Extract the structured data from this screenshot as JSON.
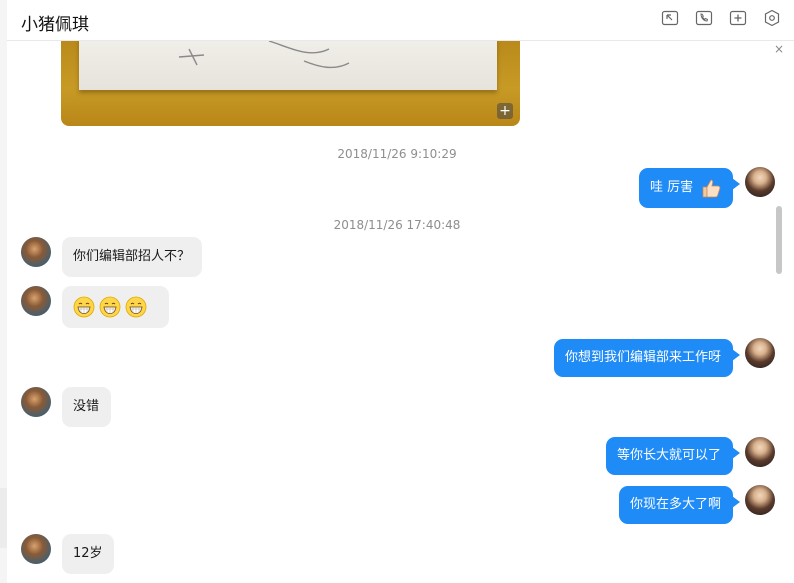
{
  "header": {
    "title": "小猪佩琪",
    "icons": [
      "minimize-corner-icon",
      "phone-icon",
      "add-icon",
      "settings-hexagon-icon"
    ]
  },
  "collapse_icon": "×",
  "timestamps": [
    "2018/11/26 9:10:29",
    "2018/11/26 17:40:48"
  ],
  "messages": [
    {
      "side": "out",
      "text": "哇 厉害",
      "emoji": "thumbs-up-icon"
    },
    {
      "side": "in",
      "text": "你们编辑部招人不？"
    },
    {
      "side": "in",
      "text": "",
      "emoji": "grinning-face-icon x3"
    },
    {
      "side": "out",
      "text": "你想到我们编辑部来工作呀"
    },
    {
      "side": "in",
      "text": "没错"
    },
    {
      "side": "out",
      "text": "等你长大就可以了"
    },
    {
      "side": "out",
      "text": "你现在多大了啊"
    },
    {
      "side": "in",
      "text": "12岁"
    }
  ],
  "colors": {
    "outgoing": "#1f8bf7",
    "incoming": "#efefef",
    "timestamp": "#8e8e8e"
  }
}
